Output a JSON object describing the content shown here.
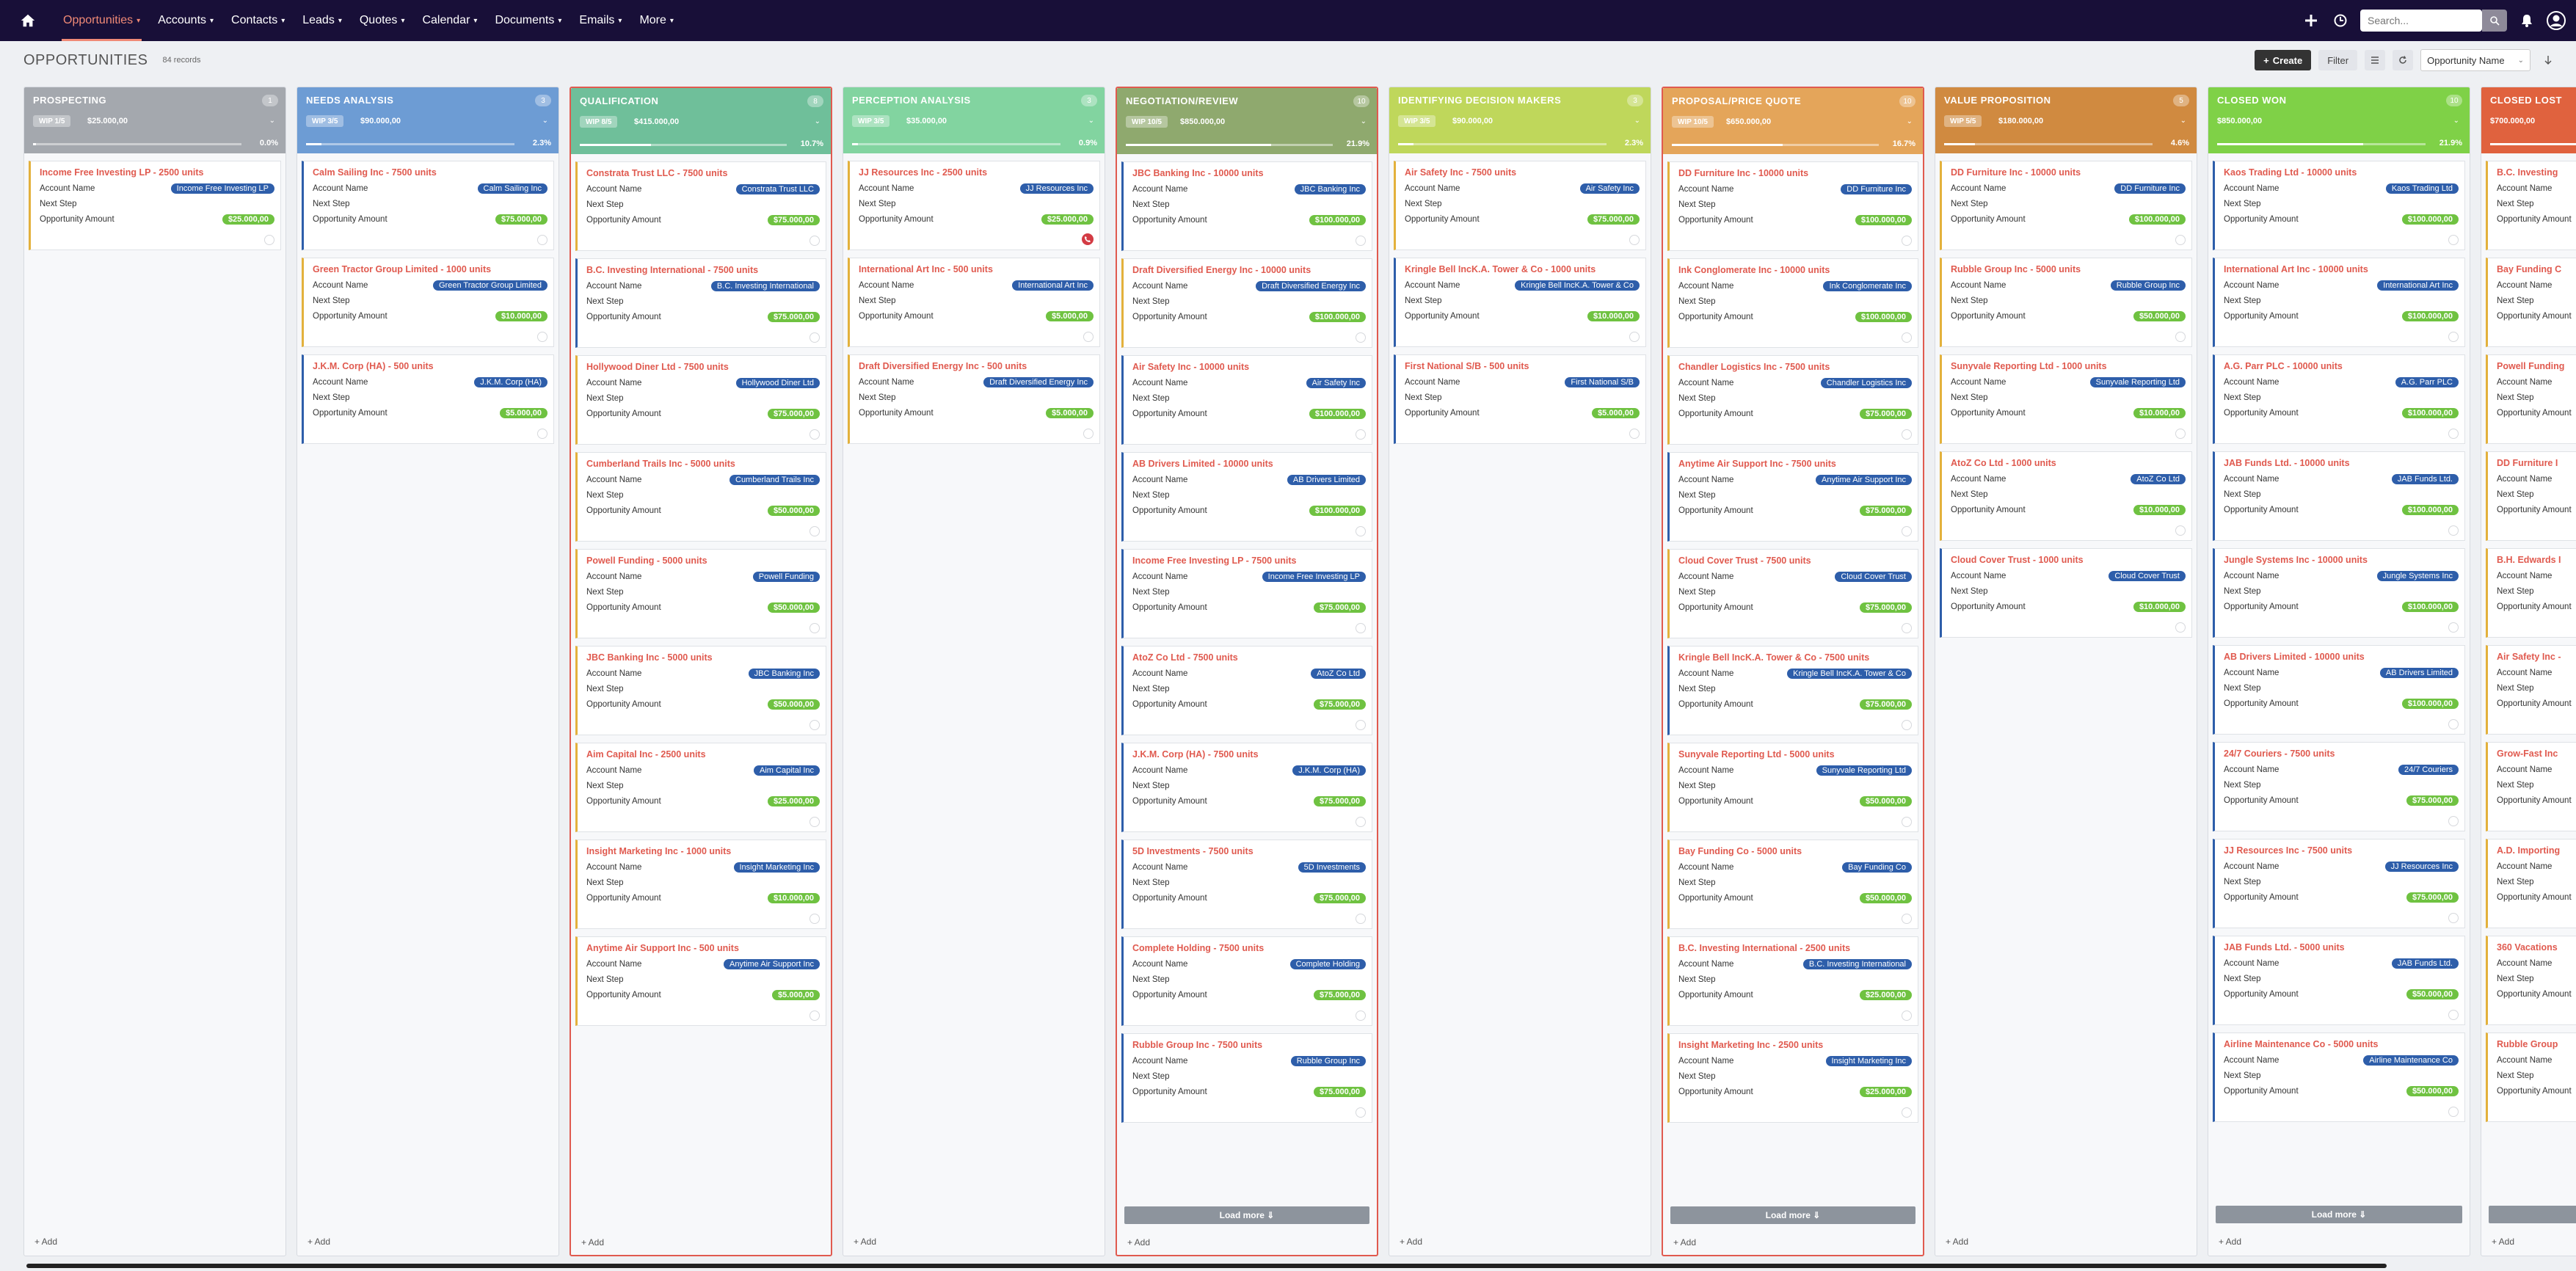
{
  "nav": {
    "home_icon": "home-icon",
    "items": [
      {
        "label": "Opportunities",
        "active": true
      },
      {
        "label": "Accounts"
      },
      {
        "label": "Contacts"
      },
      {
        "label": "Leads"
      },
      {
        "label": "Quotes"
      },
      {
        "label": "Calendar"
      },
      {
        "label": "Documents"
      },
      {
        "label": "Emails"
      },
      {
        "label": "More"
      }
    ],
    "search_placeholder": "Search...",
    "colors": {
      "bar": "#180f38",
      "active": "#f08a76"
    }
  },
  "header": {
    "title": "OPPORTUNITIES",
    "records": "84 records",
    "create_label": "Create",
    "filter_label": "Filter",
    "sort_label": "Opportunity Name"
  },
  "labels": {
    "account_name": "Account Name",
    "next_step": "Next Step",
    "opportunity_amount": "Opportunity Amount",
    "load_more": "Load more ⇓",
    "add": "+ Add"
  },
  "columns": [
    {
      "title": "PROSPECTING",
      "count": "1",
      "wip": "WIP 1/5",
      "amount": "$25.000,00",
      "percent": "0.0%",
      "progress": 0.0,
      "color": "#a4a8ae",
      "card_border": "#e3b13c",
      "highlight": false,
      "load_more": false,
      "cards": [
        {
          "title": "Income Free Investing LP - 2500 units",
          "account": "Income Free Investing LP",
          "amount": "$25.000,00"
        }
      ]
    },
    {
      "title": "NEEDS ANALYSIS",
      "count": "3",
      "wip": "WIP 3/5",
      "amount": "$90.000,00",
      "percent": "2.3%",
      "progress": 0.023,
      "color": "#6d9cd4",
      "card_border": "#2e5eaa",
      "highlight": false,
      "load_more": false,
      "cards": [
        {
          "title": "Calm Sailing Inc - 7500 units",
          "account": "Calm Sailing Inc",
          "amount": "$75.000,00",
          "border": "#2e5eaa"
        },
        {
          "title": "Green Tractor Group Limited - 1000 units",
          "account": "Green Tractor Group Limited",
          "amount": "$10.000,00",
          "border": "#e3b13c"
        },
        {
          "title": "J.K.M. Corp (HA) - 500 units",
          "account": "J.K.M. Corp (HA)",
          "amount": "$5.000,00",
          "border": "#2e5eaa"
        }
      ]
    },
    {
      "title": "QUALIFICATION",
      "count": "8",
      "wip": "WIP 8/5",
      "amount": "$415.000,00",
      "percent": "10.7%",
      "progress": 0.107,
      "color": "#6fbf9a",
      "card_border": "#e3b13c",
      "highlight": true,
      "load_more": false,
      "cards": [
        {
          "title": "Constrata Trust LLC - 7500 units",
          "account": "Constrata Trust LLC",
          "amount": "$75.000,00",
          "border": "#e3b13c"
        },
        {
          "title": "B.C. Investing International - 7500 units",
          "account": "B.C. Investing International",
          "amount": "$75.000,00",
          "border": "#2e5eaa"
        },
        {
          "title": "Hollywood Diner Ltd - 7500 units",
          "account": "Hollywood Diner Ltd",
          "amount": "$75.000,00",
          "border": "#e3b13c"
        },
        {
          "title": "Cumberland Trails Inc - 5000 units",
          "account": "Cumberland Trails Inc",
          "amount": "$50.000,00",
          "border": "#e3b13c"
        },
        {
          "title": "Powell Funding - 5000 units",
          "account": "Powell Funding",
          "amount": "$50.000,00",
          "border": "#e3b13c"
        },
        {
          "title": "JBC Banking Inc - 5000 units",
          "account": "JBC Banking Inc",
          "amount": "$50.000,00",
          "border": "#e3b13c"
        },
        {
          "title": "Aim Capital Inc - 2500 units",
          "account": "Aim Capital Inc",
          "amount": "$25.000,00",
          "border": "#e3b13c"
        },
        {
          "title": "Insight Marketing Inc - 1000 units",
          "account": "Insight Marketing Inc",
          "amount": "$10.000,00",
          "border": "#e3b13c"
        },
        {
          "title": "Anytime Air Support Inc - 500 units",
          "account": "Anytime Air Support Inc",
          "amount": "$5.000,00",
          "border": "#e3b13c"
        }
      ]
    },
    {
      "title": "PERCEPTION ANALYSIS",
      "count": "3",
      "wip": "WIP 3/5",
      "amount": "$35.000,00",
      "percent": "0.9%",
      "progress": 0.009,
      "color": "#82d4a0",
      "card_border": "#e3b13c",
      "highlight": false,
      "load_more": false,
      "cards": [
        {
          "title": "JJ Resources Inc - 2500 units",
          "account": "JJ Resources Inc",
          "amount": "$25.000,00",
          "border": "#e3b13c",
          "call": true
        },
        {
          "title": "International Art Inc - 500 units",
          "account": "International Art Inc",
          "amount": "$5.000,00",
          "border": "#e3b13c"
        },
        {
          "title": "Draft Diversified Energy Inc - 500 units",
          "account": "Draft Diversified Energy Inc",
          "amount": "$5.000,00",
          "border": "#e3b13c"
        }
      ]
    },
    {
      "title": "NEGOTIATION/REVIEW",
      "count": "10",
      "wip": "WIP 10/5",
      "amount": "$850.000,00",
      "percent": "21.9%",
      "progress": 0.219,
      "color": "#8fa96e",
      "card_border": "#2e5eaa",
      "highlight": true,
      "load_more": true,
      "cards": [
        {
          "title": "JBC Banking Inc - 10000 units",
          "account": "JBC Banking Inc",
          "amount": "$100.000,00",
          "border": "#2e5eaa"
        },
        {
          "title": "Draft Diversified Energy Inc - 10000 units",
          "account": "Draft Diversified Energy Inc",
          "amount": "$100.000,00",
          "border": "#e3b13c"
        },
        {
          "title": "Air Safety Inc - 10000 units",
          "account": "Air Safety Inc",
          "amount": "$100.000,00",
          "border": "#2e5eaa"
        },
        {
          "title": "AB Drivers Limited - 10000 units",
          "account": "AB Drivers Limited",
          "amount": "$100.000,00",
          "border": "#2e5eaa"
        },
        {
          "title": "Income Free Investing LP - 7500 units",
          "account": "Income Free Investing LP",
          "amount": "$75.000,00",
          "border": "#2e5eaa"
        },
        {
          "title": "AtoZ Co Ltd - 7500 units",
          "account": "AtoZ Co Ltd",
          "amount": "$75.000,00",
          "border": "#2e5eaa"
        },
        {
          "title": "J.K.M. Corp (HA) - 7500 units",
          "account": "J.K.M. Corp (HA)",
          "amount": "$75.000,00",
          "border": "#2e5eaa"
        },
        {
          "title": "5D Investments - 7500 units",
          "account": "5D Investments",
          "amount": "$75.000,00",
          "border": "#2e5eaa"
        },
        {
          "title": "Complete Holding - 7500 units",
          "account": "Complete Holding",
          "amount": "$75.000,00",
          "border": "#2e5eaa"
        },
        {
          "title": "Rubble Group Inc - 7500 units",
          "account": "Rubble Group Inc",
          "amount": "$75.000,00",
          "border": "#2e5eaa"
        }
      ]
    },
    {
      "title": "IDENTIFYING DECISION MAKERS",
      "count": "3",
      "wip": "WIP 3/5",
      "amount": "$90.000,00",
      "percent": "2.3%",
      "progress": 0.023,
      "color": "#bfd75b",
      "card_border": "#2e5eaa",
      "highlight": false,
      "load_more": false,
      "cards": [
        {
          "title": "Air Safety Inc - 7500 units",
          "account": "Air Safety Inc",
          "amount": "$75.000,00",
          "border": "#e3b13c"
        },
        {
          "title": "Kringle Bell IncK.A. Tower & Co - 1000 units",
          "account": "Kringle Bell IncK.A. Tower & Co",
          "amount": "$10.000,00",
          "border": "#2e5eaa"
        },
        {
          "title": "First National S/B - 500 units",
          "account": "First National S/B",
          "amount": "$5.000,00",
          "border": "#2e5eaa"
        }
      ]
    },
    {
      "title": "PROPOSAL/PRICE QUOTE",
      "count": "10",
      "wip": "WIP 10/5",
      "amount": "$650.000,00",
      "percent": "16.7%",
      "progress": 0.167,
      "color": "#e4a55a",
      "card_border": "#e3b13c",
      "highlight": true,
      "load_more": true,
      "cards": [
        {
          "title": "DD Furniture Inc - 10000 units",
          "account": "DD Furniture Inc",
          "amount": "$100.000,00",
          "border": "#e3b13c"
        },
        {
          "title": "Ink Conglomerate Inc - 10000 units",
          "account": "Ink Conglomerate Inc",
          "amount": "$100.000,00",
          "border": "#e3b13c"
        },
        {
          "title": "Chandler Logistics Inc - 7500 units",
          "account": "Chandler Logistics Inc",
          "amount": "$75.000,00",
          "border": "#e3b13c"
        },
        {
          "title": "Anytime Air Support Inc - 7500 units",
          "account": "Anytime Air Support Inc",
          "amount": "$75.000,00",
          "border": "#2e5eaa"
        },
        {
          "title": "Cloud Cover Trust - 7500 units",
          "account": "Cloud Cover Trust",
          "amount": "$75.000,00",
          "border": "#e3b13c"
        },
        {
          "title": "Kringle Bell IncK.A. Tower & Co - 7500 units",
          "account": "Kringle Bell IncK.A. Tower & Co",
          "amount": "$75.000,00",
          "border": "#2e5eaa"
        },
        {
          "title": "Sunyvale Reporting Ltd - 5000 units",
          "account": "Sunyvale Reporting Ltd",
          "amount": "$50.000,00",
          "border": "#e3b13c"
        },
        {
          "title": "Bay Funding Co - 5000 units",
          "account": "Bay Funding Co",
          "amount": "$50.000,00",
          "border": "#e3b13c"
        },
        {
          "title": "B.C. Investing International - 2500 units",
          "account": "B.C. Investing International",
          "amount": "$25.000,00",
          "border": "#e3b13c"
        },
        {
          "title": "Insight Marketing Inc - 2500 units",
          "account": "Insight Marketing Inc",
          "amount": "$25.000,00",
          "border": "#e3b13c"
        }
      ]
    },
    {
      "title": "VALUE PROPOSITION",
      "count": "5",
      "wip": "WIP 5/5",
      "amount": "$180.000,00",
      "percent": "4.6%",
      "progress": 0.046,
      "color": "#d08a40",
      "card_border": "#e3b13c",
      "highlight": false,
      "load_more": false,
      "cards": [
        {
          "title": "DD Furniture Inc - 10000 units",
          "account": "DD Furniture Inc",
          "amount": "$100.000,00",
          "border": "#e3b13c"
        },
        {
          "title": "Rubble Group Inc - 5000 units",
          "account": "Rubble Group Inc",
          "amount": "$50.000,00",
          "border": "#e3b13c"
        },
        {
          "title": "Sunyvale Reporting Ltd - 1000 units",
          "account": "Sunyvale Reporting Ltd",
          "amount": "$10.000,00",
          "border": "#e3b13c"
        },
        {
          "title": "AtoZ Co Ltd - 1000 units",
          "account": "AtoZ Co Ltd",
          "amount": "$10.000,00",
          "border": "#e3b13c"
        },
        {
          "title": "Cloud Cover Trust - 1000 units",
          "account": "Cloud Cover Trust",
          "amount": "$10.000,00",
          "border": "#2e5eaa"
        }
      ]
    },
    {
      "title": "CLOSED WON",
      "count": "10",
      "wip": "",
      "amount": "$850.000,00",
      "percent": "21.9%",
      "progress": 0.219,
      "color": "#7fd147",
      "card_border": "#2e5eaa",
      "highlight": false,
      "load_more": true,
      "cards": [
        {
          "title": "Kaos Trading Ltd - 10000 units",
          "account": "Kaos Trading Ltd",
          "amount": "$100.000,00",
          "border": "#2e5eaa"
        },
        {
          "title": "International Art Inc - 10000 units",
          "account": "International Art Inc",
          "amount": "$100.000,00",
          "border": "#2e5eaa"
        },
        {
          "title": "A.G. Parr PLC - 10000 units",
          "account": "A.G. Parr PLC",
          "amount": "$100.000,00",
          "border": "#2e5eaa"
        },
        {
          "title": "JAB Funds Ltd. - 10000 units",
          "account": "JAB Funds Ltd.",
          "amount": "$100.000,00",
          "border": "#2e5eaa"
        },
        {
          "title": "Jungle Systems Inc - 10000 units",
          "account": "Jungle Systems Inc",
          "amount": "$100.000,00",
          "border": "#2e5eaa"
        },
        {
          "title": "AB Drivers Limited - 10000 units",
          "account": "AB Drivers Limited",
          "amount": "$100.000,00",
          "border": "#2e5eaa"
        },
        {
          "title": "24/7 Couriers - 7500 units",
          "account": "24/7 Couriers",
          "amount": "$75.000,00",
          "border": "#2e5eaa"
        },
        {
          "title": "JJ Resources Inc - 7500 units",
          "account": "JJ Resources Inc",
          "amount": "$75.000,00",
          "border": "#2e5eaa"
        },
        {
          "title": "JAB Funds Ltd. - 5000 units",
          "account": "JAB Funds Ltd.",
          "amount": "$50.000,00",
          "border": "#2e5eaa"
        },
        {
          "title": "Airline Maintenance Co - 5000 units",
          "account": "Airline Maintenance Co",
          "amount": "$50.000,00",
          "border": "#2e5eaa"
        }
      ]
    },
    {
      "title": "CLOSED LOST",
      "count": "",
      "wip": "",
      "amount": "$700.000,00",
      "percent": "",
      "progress": 0.18,
      "color": "#e0623e",
      "card_border": "#e3b13c",
      "highlight": false,
      "load_more": true,
      "cards": [
        {
          "title": "B.C. Investing",
          "account": "",
          "amount": "",
          "border": "#e3b13c"
        },
        {
          "title": "Bay Funding C",
          "account": "",
          "amount": "",
          "border": "#e3b13c"
        },
        {
          "title": "Powell Funding",
          "account": "",
          "amount": "",
          "border": "#e3b13c"
        },
        {
          "title": "DD Furniture I",
          "account": "",
          "amount": "",
          "border": "#e3b13c"
        },
        {
          "title": "B.H. Edwards I",
          "account": "",
          "amount": "",
          "border": "#e3b13c"
        },
        {
          "title": "Air Safety Inc -",
          "account": "",
          "amount": "",
          "border": "#e3b13c"
        },
        {
          "title": "Grow-Fast Inc",
          "account": "",
          "amount": "",
          "border": "#e3b13c"
        },
        {
          "title": "A.D. Importing",
          "account": "",
          "amount": "",
          "border": "#e3b13c"
        },
        {
          "title": "360 Vacations",
          "account": "",
          "amount": "",
          "border": "#e3b13c"
        },
        {
          "title": "Rubble Group",
          "account": "",
          "amount": "",
          "border": "#e3b13c"
        }
      ]
    }
  ]
}
